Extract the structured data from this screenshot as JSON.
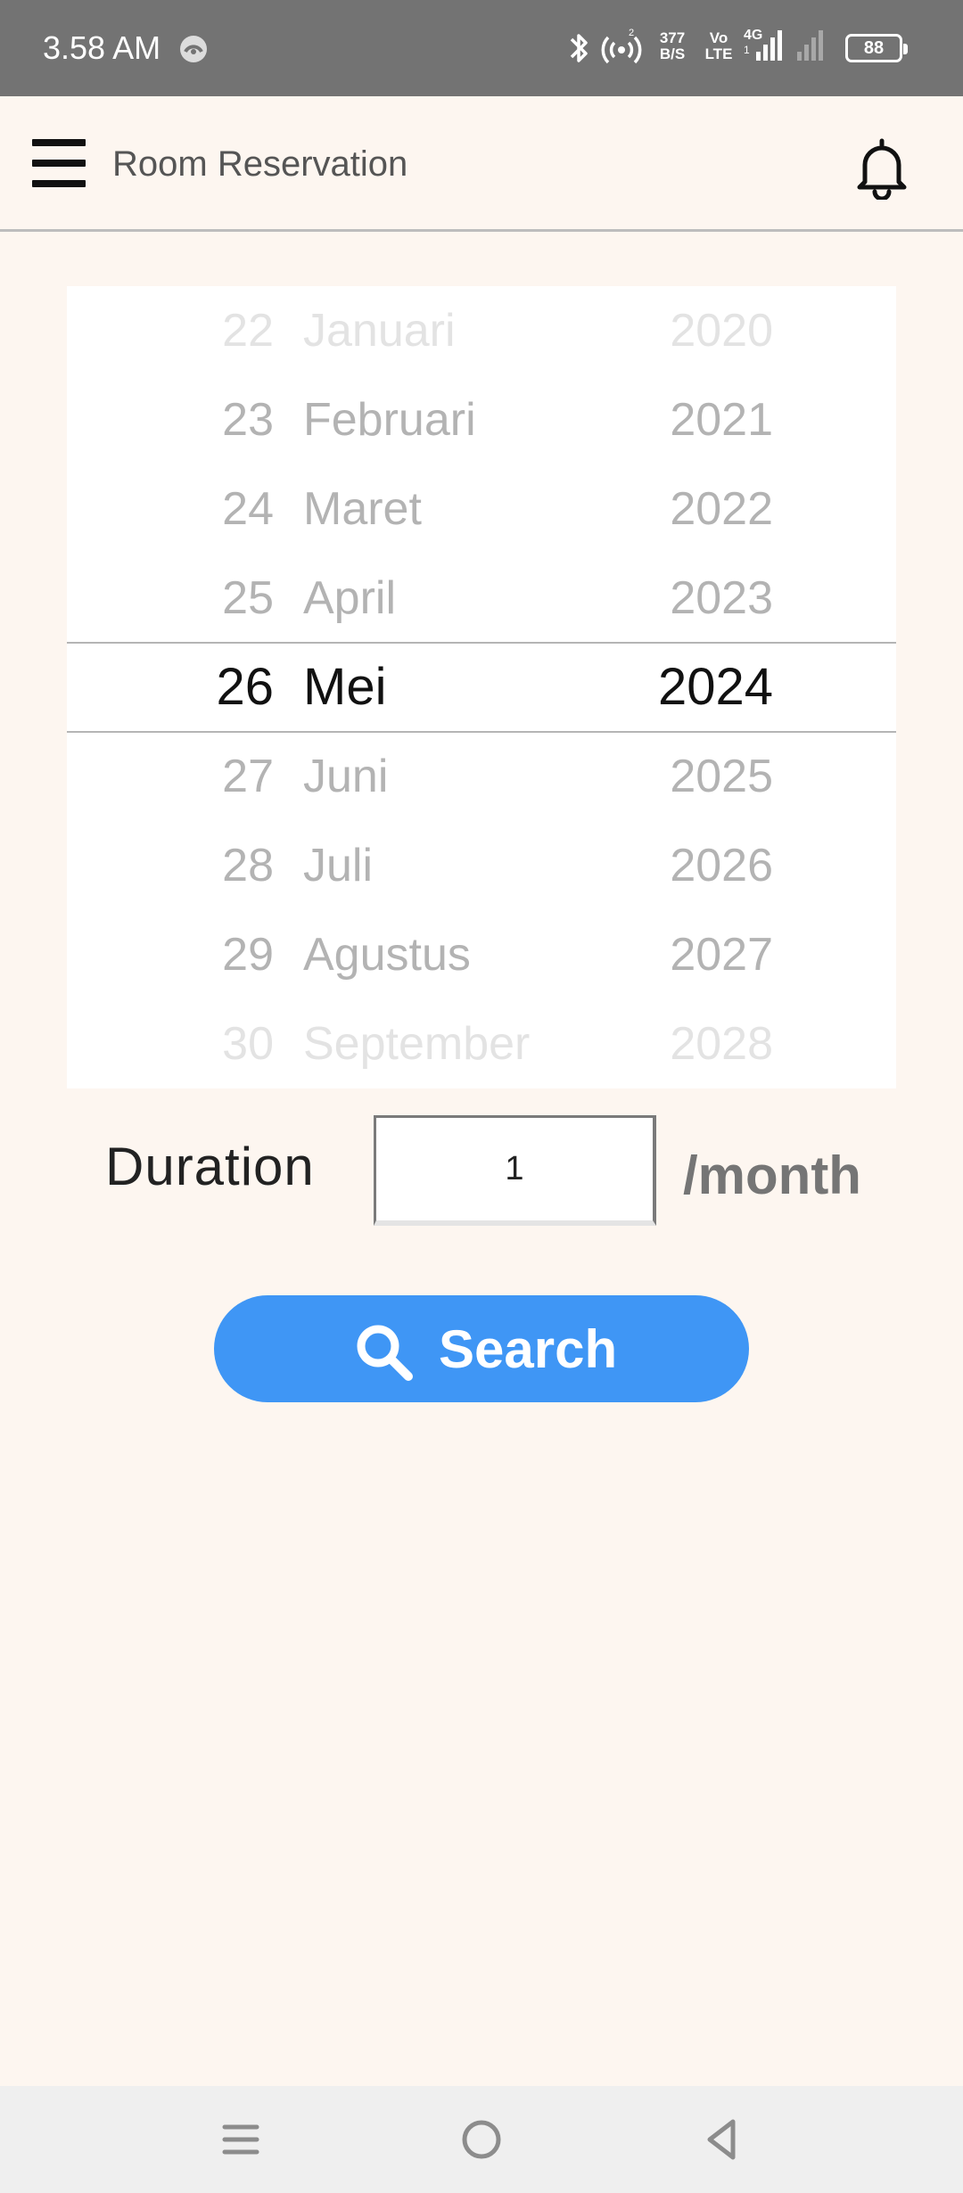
{
  "status_bar": {
    "time": "3.58 AM",
    "net_speed_value": "377",
    "net_speed_unit": "B/S",
    "volte_top": "Vo",
    "volte_bottom": "LTE",
    "network_type": "4G",
    "sim_slot": "1",
    "battery": "88",
    "icons": [
      "sync-icon",
      "bluetooth-icon",
      "hotspot-icon",
      "signal-icon",
      "signal-weak-icon",
      "battery-icon"
    ]
  },
  "header": {
    "title": "Room Reservation",
    "menu_icon": "hamburger-menu-icon",
    "notification_icon": "bell-icon"
  },
  "date_picker": {
    "rows": [
      {
        "day": "22",
        "month": "Januari",
        "year": "2020"
      },
      {
        "day": "23",
        "month": "Februari",
        "year": "2021"
      },
      {
        "day": "24",
        "month": "Maret",
        "year": "2022"
      },
      {
        "day": "25",
        "month": "April",
        "year": "2023"
      },
      {
        "day": "26",
        "month": "Mei",
        "year": "2024"
      },
      {
        "day": "27",
        "month": "Juni",
        "year": "2025"
      },
      {
        "day": "28",
        "month": "Juli",
        "year": "2026"
      },
      {
        "day": "29",
        "month": "Agustus",
        "year": "2027"
      },
      {
        "day": "30",
        "month": "September",
        "year": "2028"
      }
    ],
    "selected": {
      "day": "26",
      "month": "Mei",
      "year": "2024"
    }
  },
  "duration": {
    "label": "Duration",
    "value": "1",
    "unit": "/month"
  },
  "search_button": {
    "label": "Search",
    "icon": "search-icon",
    "color": "#3f96f5"
  },
  "nav_bar": {
    "icons": [
      "recent-apps-icon",
      "home-icon",
      "back-icon"
    ]
  },
  "colors": {
    "background": "#fdf6f0",
    "status_bar": "#737373",
    "accent": "#3f96f5"
  }
}
